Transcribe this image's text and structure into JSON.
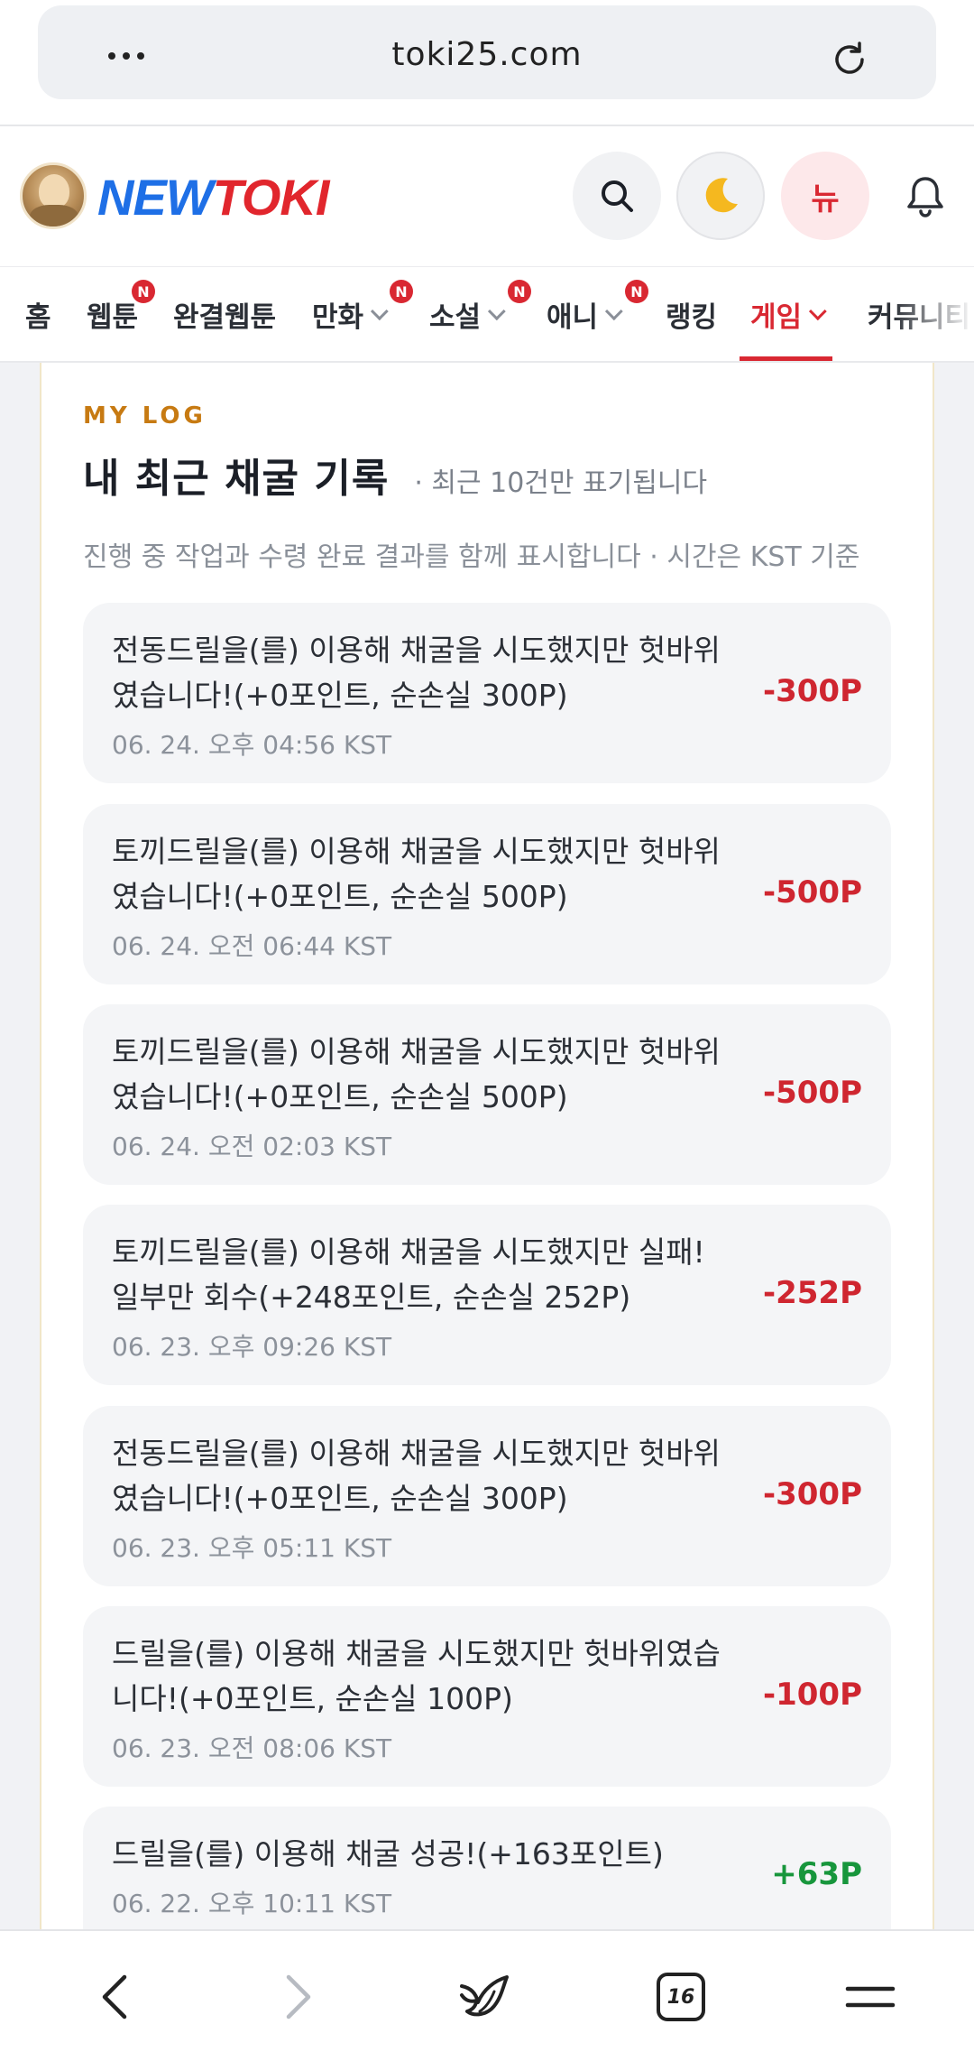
{
  "browser": {
    "url": "toki25.com",
    "tab_count": "16"
  },
  "header": {
    "logo_new": "NEW",
    "logo_toki": "TOKI",
    "new_button_label": "뉴"
  },
  "nav": {
    "items": [
      {
        "label": "홈"
      },
      {
        "label": "웹툰",
        "badge": "N"
      },
      {
        "label": "완결웹툰"
      },
      {
        "label": "만화",
        "badge": "N"
      },
      {
        "label": "소설",
        "badge": "N"
      },
      {
        "label": "애니",
        "badge": "N"
      },
      {
        "label": "랭킹"
      },
      {
        "label": "게임"
      },
      {
        "label": "커뮤니티"
      }
    ],
    "active": "게임"
  },
  "section": {
    "eyebrow": "MY LOG",
    "title": "내 최근 채굴 기록",
    "title_note": "· 최근 10건만 표기됩니다",
    "subtitle": "진행 중 작업과 수령 완료 결과를 함께 표시합니다 · 시간은 KST 기준"
  },
  "logs": [
    {
      "line1": "전동드릴을(를) 이용해 채굴을 시도했지만 헛바위",
      "line2": "였습니다!(+0포인트, 순손실 300P)",
      "time": "06. 24. 오후 04:56 KST",
      "amount": "-300P",
      "sign": "neg"
    },
    {
      "line1": "토끼드릴을(를) 이용해 채굴을 시도했지만 헛바위",
      "line2": "였습니다!(+0포인트, 순손실 500P)",
      "time": "06. 24. 오전 06:44 KST",
      "amount": "-500P",
      "sign": "neg"
    },
    {
      "line1": "토끼드릴을(를) 이용해 채굴을 시도했지만 헛바위",
      "line2": "였습니다!(+0포인트, 순손실 500P)",
      "time": "06. 24. 오전 02:03 KST",
      "amount": "-500P",
      "sign": "neg"
    },
    {
      "line1": "토끼드릴을(를) 이용해 채굴을 시도했지만 실패!",
      "line2": "일부만 회수(+248포인트, 순손실 252P)",
      "time": "06. 23. 오후 09:26 KST",
      "amount": "-252P",
      "sign": "neg"
    },
    {
      "line1": "전동드릴을(를) 이용해 채굴을 시도했지만 헛바위",
      "line2": "였습니다!(+0포인트, 순손실 300P)",
      "time": "06. 23. 오후 05:11 KST",
      "amount": "-300P",
      "sign": "neg"
    },
    {
      "line1": "드릴을(를) 이용해 채굴을 시도했지만 헛바위였습",
      "line2": "니다!(+0포인트, 순손실 100P)",
      "time": "06. 23. 오전 08:06 KST",
      "amount": "-100P",
      "sign": "neg"
    },
    {
      "line1": "드릴을(를) 이용해 채굴 성공!(+163포인트)",
      "line2": "",
      "time": "06. 22. 오후 10:11 KST",
      "amount": "+63P",
      "sign": "pos"
    }
  ],
  "colors": {
    "accent_red": "#d92832",
    "positive_green": "#17963c",
    "eyebrow_orange": "#c77a12"
  },
  "icons": [
    "more-icon",
    "reload-icon",
    "search-icon",
    "moon-icon",
    "bell-icon",
    "back-icon",
    "forward-icon",
    "whale-icon",
    "tabs-icon",
    "menu-icon"
  ]
}
